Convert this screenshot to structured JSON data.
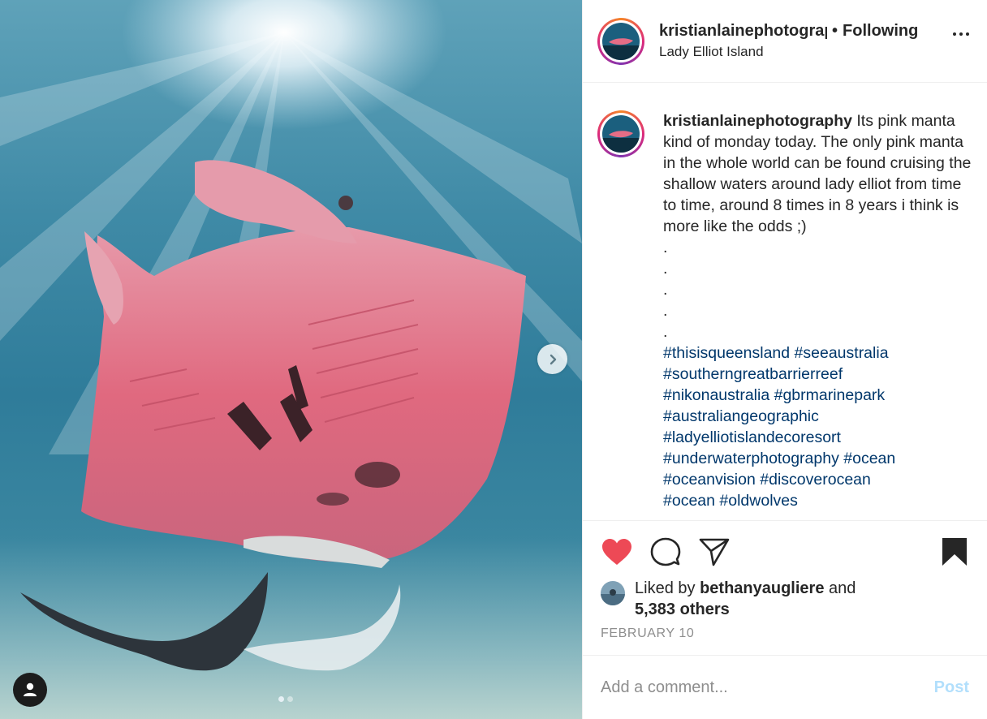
{
  "media": {
    "image_description": "",
    "carousel_dots": 2,
    "active_dot": 0
  },
  "header": {
    "username": "kristianlainephotography",
    "separator": "•",
    "follow_status": "Following",
    "location": "Lady Elliot Island"
  },
  "caption": {
    "username": "kristianlainephotography",
    "text": "Its pink manta kind of monday today. The only pink manta in the whole world can be found cruising the shallow waters around lady elliot from time to time, around 8 times in 8 years i think is more like the odds ;)",
    "dots": [
      ".",
      ".",
      ".",
      ".",
      "."
    ],
    "hashtags": [
      [
        "#thisisqueensland",
        "#seeaustralia"
      ],
      [
        "#southerngreatbarrierreef"
      ],
      [
        "#nikonaustralia",
        "#gbrmarinepark"
      ],
      [
        "#australiangeographic"
      ],
      [
        "#ladyelliotislandecoresort"
      ],
      [
        "#underwaterphotography",
        "#ocean"
      ],
      [
        "#oceanvision",
        "#discoverocean"
      ],
      [
        "#ocean",
        "#oldwolves"
      ]
    ]
  },
  "actions": {
    "liked": true,
    "like_color": "#ed4956",
    "likes_prefix": "Liked by",
    "liked_by_user": "bethanyaugliere",
    "likes_and": "and",
    "likes_others": "5,383 others",
    "date": "FEBRUARY 10"
  },
  "comment_box": {
    "placeholder": "Add a comment...",
    "post_label": "Post"
  }
}
